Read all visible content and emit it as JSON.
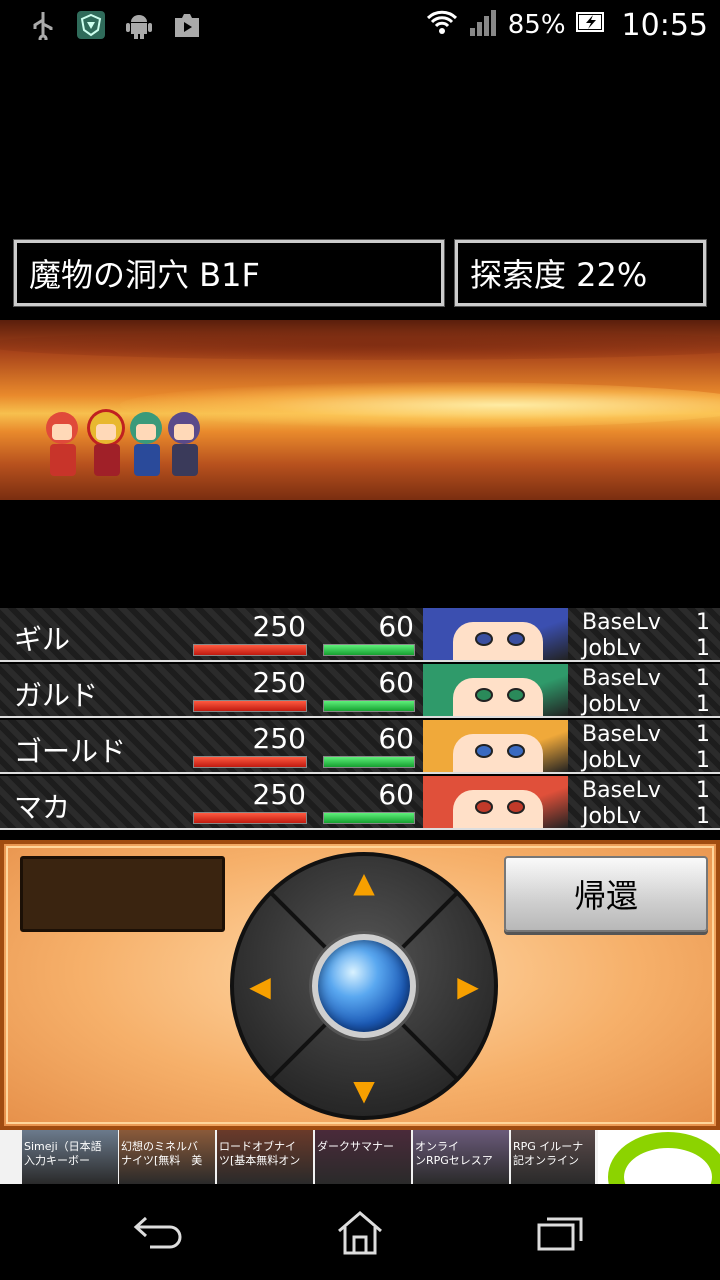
{
  "status_bar": {
    "battery": "85%",
    "time": "10:55",
    "icons": [
      "usb-icon",
      "shield-app-icon",
      "android-icon",
      "play-store-icon",
      "wifi-icon",
      "signal-icon",
      "battery-charging-icon"
    ]
  },
  "location": {
    "name": "魔物の洞穴 B1F"
  },
  "exploration": {
    "label": "探索度 22%"
  },
  "party": [
    {
      "name": "ギル",
      "hp": "250",
      "mp": "60",
      "hp_ratio": 1.0,
      "mp_ratio": 1.0,
      "base_label": "BaseLv",
      "base_lv": "1",
      "job_label": "JobLv",
      "job_lv": "1",
      "hair_color": "#3b4fb0"
    },
    {
      "name": "ガルド",
      "hp": "250",
      "mp": "60",
      "hp_ratio": 1.0,
      "mp_ratio": 1.0,
      "base_label": "BaseLv",
      "base_lv": "1",
      "job_label": "JobLv",
      "job_lv": "1",
      "hair_color": "#2f9a6a"
    },
    {
      "name": "ゴールド",
      "hp": "250",
      "mp": "60",
      "hp_ratio": 1.0,
      "mp_ratio": 1.0,
      "base_label": "BaseLv",
      "base_lv": "1",
      "job_label": "JobLv",
      "job_lv": "1",
      "hair_color": "#f0a93a"
    },
    {
      "name": "マカ",
      "hp": "250",
      "mp": "60",
      "hp_ratio": 1.0,
      "mp_ratio": 1.0,
      "base_label": "BaseLv",
      "base_lv": "1",
      "job_label": "JobLv",
      "job_lv": "1",
      "hair_color": "#e0503a"
    }
  ],
  "controls": {
    "return_label": "帰還",
    "arrows": {
      "up": "▲",
      "down": "▼",
      "left": "◀",
      "right": "▶"
    }
  },
  "ad_banner": {
    "items": [
      {
        "line1": "Simeji（日本語",
        "line2": "入力キーボー",
        "color": "#6b7a8c"
      },
      {
        "line1": "幻想のミネルバ",
        "line2": "ナイツ[無料　美",
        "color": "#8a5a3a"
      },
      {
        "line1": "ロードオブナイ",
        "line2": "ツ[基本無料オン",
        "color": "#6a3a2a"
      },
      {
        "line1": "ダークサマナー",
        "line2": "",
        "color": "#4a2a3a"
      },
      {
        "line1": "オンライ",
        "line2": "ンRPGセレスア",
        "color": "#6a5a7a"
      },
      {
        "line1": "RPG イルーナ",
        "line2": "記オンライン",
        "color": "#5a4a4a"
      }
    ]
  },
  "colors": {
    "hp_bar": "#d8261a",
    "mp_bar": "#22c040",
    "panel_orange": "#f6b06a",
    "orb_blue": "#1c5bb8"
  }
}
